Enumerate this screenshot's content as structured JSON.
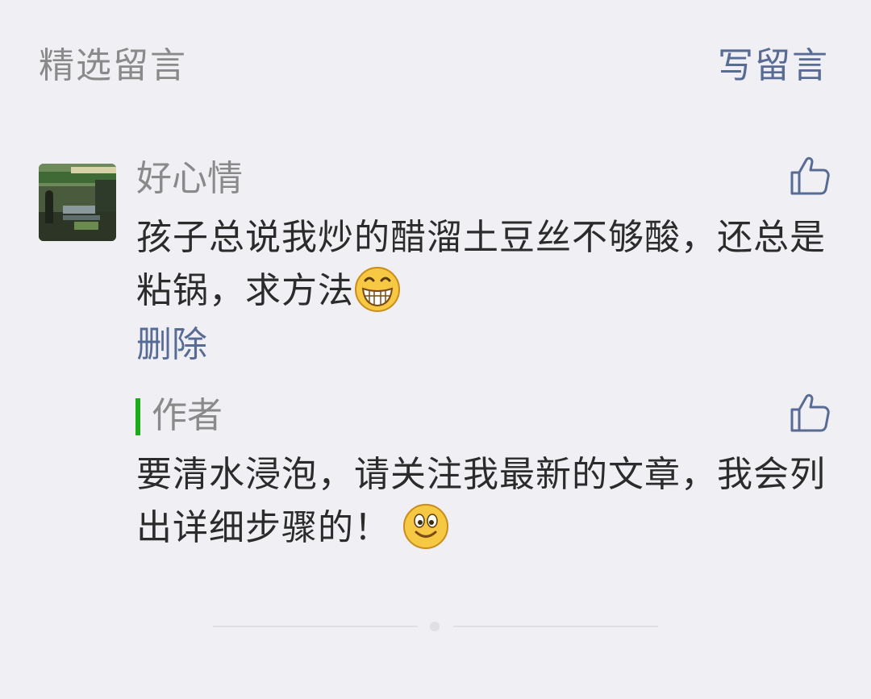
{
  "header": {
    "title": "精选留言",
    "write_label": "写留言"
  },
  "comment": {
    "nickname": "好心情",
    "text": "孩子总说我炒的醋溜土豆丝不够酸，还总是粘锅，求方法",
    "emoji": "grin-emoji",
    "delete_label": "删除",
    "like_icon": "thumbs-up-icon"
  },
  "reply": {
    "author_label": "作者",
    "text": "要清水浸泡，请关注我最新的文章，我会列出详细步骤的！",
    "emoji": "smile-emoji",
    "like_icon": "thumbs-up-icon"
  },
  "colors": {
    "background": "#efeff4",
    "link": "#576b95",
    "muted": "#8a8a8a",
    "body_text": "#2b2b2b",
    "author_bar": "#1aad19"
  }
}
